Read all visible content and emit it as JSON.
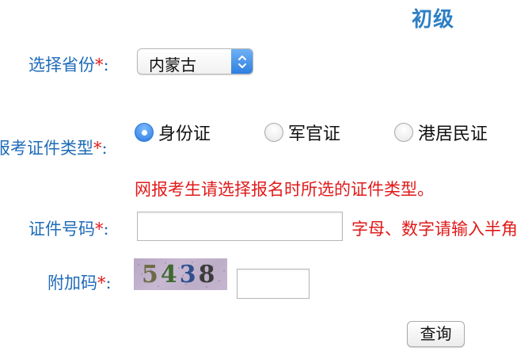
{
  "header": {
    "title": "初级"
  },
  "form": {
    "province": {
      "label": "选择省份",
      "required_mark": "*",
      "colon": ":",
      "selected": "内蒙古"
    },
    "id_type": {
      "label": "报考证件类型",
      "required_mark": "*",
      "colon": ":",
      "options": [
        {
          "label": "身份证",
          "checked": true
        },
        {
          "label": "军官证",
          "checked": false
        },
        {
          "label": "港居民证",
          "checked": false
        }
      ],
      "notice": "网报考生请选择报名时所选的证件类型。"
    },
    "id_number": {
      "label": "证件号码",
      "required_mark": "*",
      "colon": ":",
      "value": "",
      "hint": "字母、数字请输入半角"
    },
    "captcha": {
      "label": "附加码",
      "required_mark": "*",
      "colon": ":",
      "image_digits": [
        "5",
        "4",
        "3",
        "8"
      ],
      "digit_colors": [
        "#6b6b45",
        "#3d6a2f",
        "#2e4f8c",
        "#3b3b3b"
      ],
      "value": ""
    },
    "submit_label": "查询"
  },
  "colors": {
    "label": "#1f6bb8",
    "required": "#e01a1a",
    "title": "#2f7fc4",
    "accent": "#2b78e0"
  }
}
